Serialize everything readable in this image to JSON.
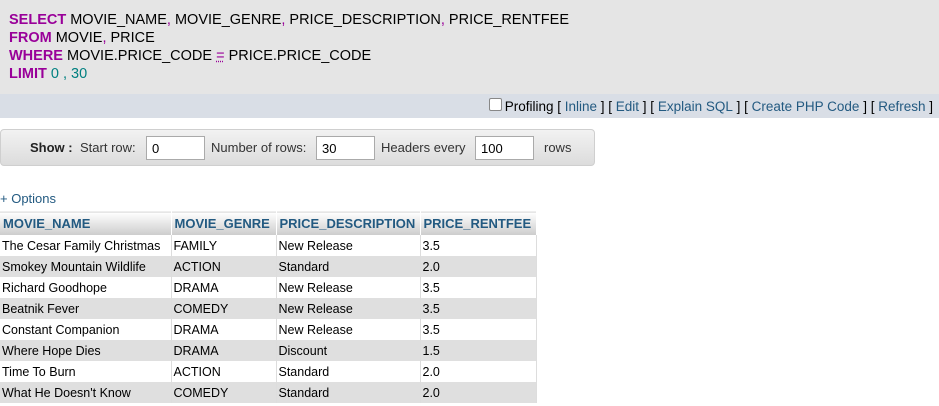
{
  "sql": {
    "select_kw": "SELECT",
    "select_cols": [
      " MOVIE_NAME",
      " MOVIE_GENRE",
      " PRICE_DESCRIPTION",
      " PRICE_RENTFEE"
    ],
    "comma": ",",
    "from_kw": "FROM",
    "from_tables": [
      " MOVIE",
      " PRICE"
    ],
    "where_kw": "WHERE",
    "where_left": " MOVIE.PRICE_CODE ",
    "where_op": "=",
    "where_right": " PRICE.PRICE_CODE",
    "limit_kw": "LIMIT",
    "limit_start": " 0",
    "limit_sep": " ,",
    "limit_count": " 30"
  },
  "links": {
    "profiling": "Profiling",
    "inline": "Inline",
    "edit": "Edit",
    "explain": "Explain SQL",
    "php": "Create PHP Code",
    "refresh": "Refresh",
    "open": " [ ",
    "close": " ]",
    "mid": " ] [ "
  },
  "show": {
    "label": "Show :",
    "start_row_label": "Start row:",
    "start_row_value": "0",
    "num_rows_label": "Number of rows:",
    "num_rows_value": "30",
    "headers_every_label": "Headers every",
    "headers_every_value": "100",
    "rows_label": "rows"
  },
  "options_link": "+ Options",
  "table": {
    "headers": [
      "MOVIE_NAME",
      "MOVIE_GENRE",
      "PRICE_DESCRIPTION",
      "PRICE_RENTFEE"
    ],
    "rows": [
      [
        "The Cesar Family Christmas",
        "FAMILY",
        "New Release",
        "3.5"
      ],
      [
        "Smokey Mountain Wildlife",
        "ACTION",
        "Standard",
        "2.0"
      ],
      [
        "Richard Goodhope",
        "DRAMA",
        "New Release",
        "3.5"
      ],
      [
        "Beatnik Fever",
        "COMEDY",
        "New Release",
        "3.5"
      ],
      [
        "Constant Companion",
        "DRAMA",
        "New Release",
        "3.5"
      ],
      [
        "Where Hope Dies",
        "DRAMA",
        "Discount",
        "1.5"
      ],
      [
        "Time To Burn",
        "ACTION",
        "Standard",
        "2.0"
      ],
      [
        "What He Doesn't Know",
        "COMEDY",
        "Standard",
        "2.0"
      ]
    ]
  }
}
